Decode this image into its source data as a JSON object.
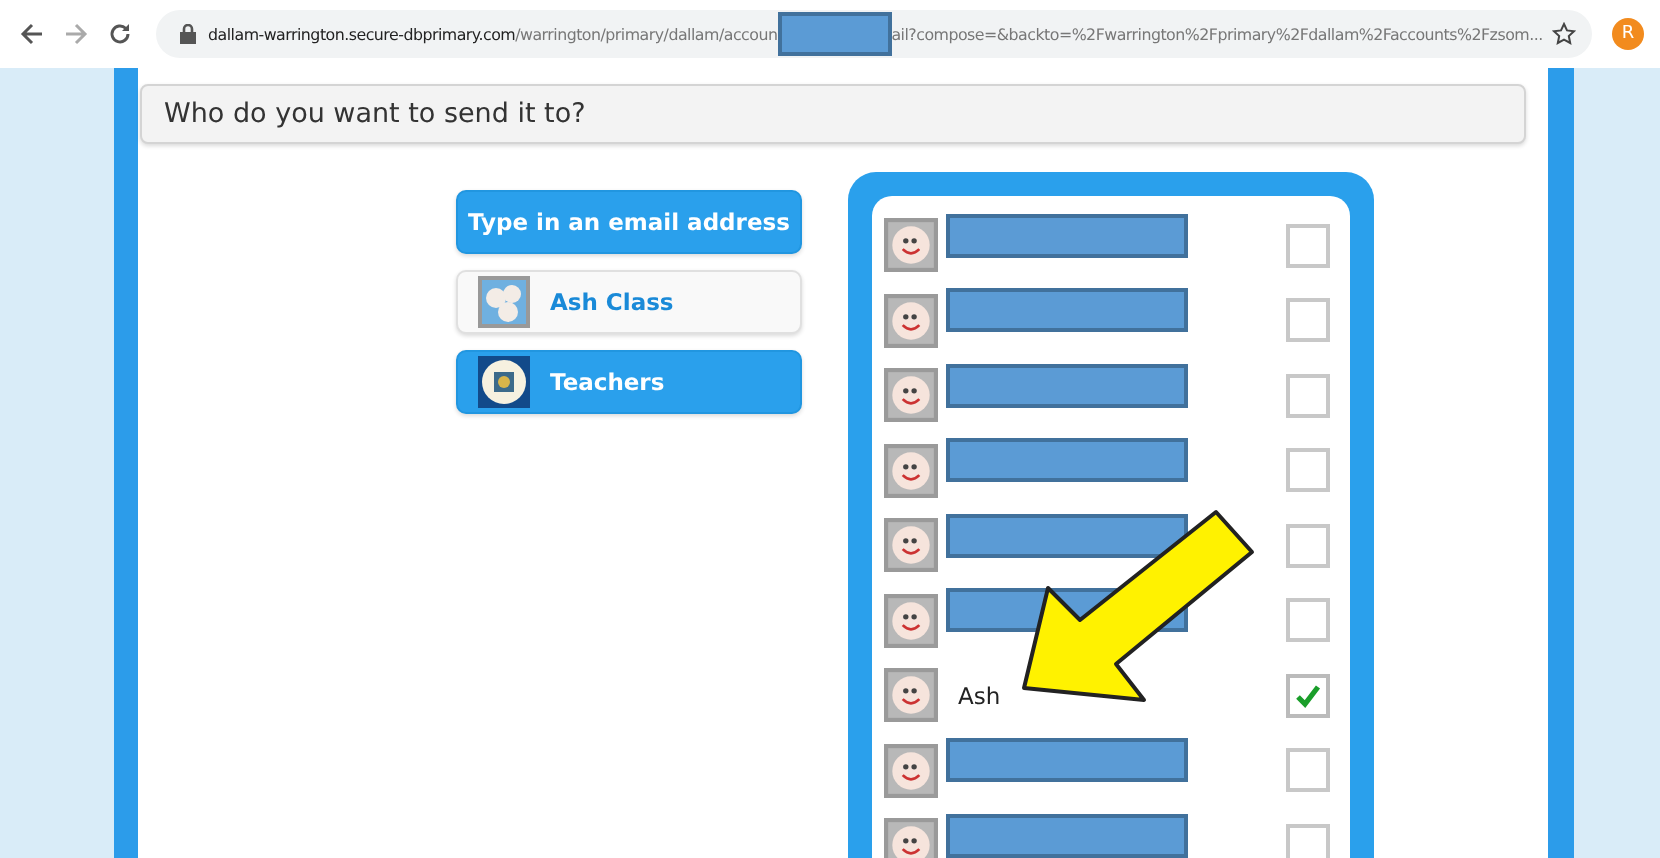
{
  "browser": {
    "url": {
      "host": "dallam-warrington.secure-dbprimary.com",
      "path_before": "/warrington/primary/dallam/accoun",
      "path_after": "ail?compose=&backto=%2Fwarrington%2Fprimary%2Fdallam%2Faccounts%2Fzsom..."
    },
    "profile_initial": "R"
  },
  "prompt": "Who do you want to send it to?",
  "options": [
    {
      "label": "Type in an email address",
      "kind": "email",
      "selected": true
    },
    {
      "label": "Ash Class",
      "kind": "class",
      "selected": false
    },
    {
      "label": "Teachers",
      "kind": "teachers",
      "selected": true
    }
  ],
  "recipients": [
    {
      "redacted": true,
      "checked": false
    },
    {
      "redacted": true,
      "checked": false
    },
    {
      "redacted": true,
      "checked": false
    },
    {
      "redacted": true,
      "checked": false
    },
    {
      "redacted": true,
      "checked": false
    },
    {
      "redacted": true,
      "checked": false
    },
    {
      "name": "Ash",
      "checked": true
    },
    {
      "redacted": true,
      "checked": false
    },
    {
      "redacted": true,
      "checked": false
    }
  ],
  "annotations": [
    {
      "kind": "arrow"
    }
  ]
}
